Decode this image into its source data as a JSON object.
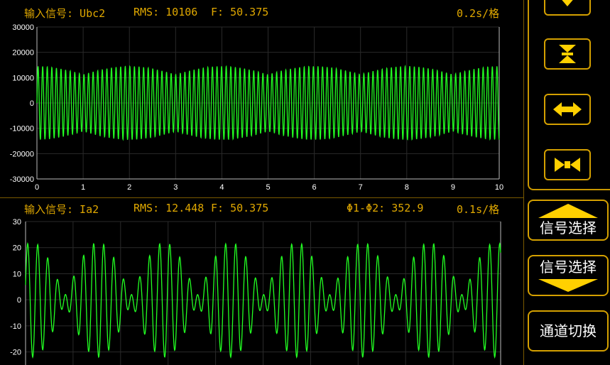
{
  "top_panel": {
    "signal_label": "输入信号: Ubc2",
    "rms": "RMS: 10106",
    "freq": "F: 50.375",
    "timebase": "0.2s/格",
    "y_ticks": [
      "30000",
      "20000",
      "10000",
      "0",
      "-10000",
      "-20000",
      "-30000"
    ],
    "x_ticks": [
      "0",
      "1",
      "2",
      "3",
      "4",
      "5",
      "6",
      "7",
      "8",
      "9",
      "10"
    ]
  },
  "bottom_panel": {
    "signal_label": "输入信号: Ia2",
    "rms": "RMS: 12.448",
    "freq": "F: 50.375",
    "phase": "Φ1-Φ2: 352.9",
    "timebase": "0.1s/格",
    "y_ticks": [
      "30",
      "20",
      "10",
      "0",
      "-10",
      "-20"
    ]
  },
  "buttons": {
    "signal_select_up": "信号选择",
    "signal_select_down": "信号选择",
    "channel_switch": "通道切换"
  },
  "colors": {
    "accent": "#ffc000",
    "trace": "#22ff22",
    "grid": "#2a2a2a",
    "background": "#000000"
  },
  "chart_data": [
    {
      "type": "line",
      "series": [
        {
          "amplitude_peak": 14500,
          "envelope_min": 8000
        }
      ],
      "ylim": [
        -30000,
        30000
      ],
      "xlim": [
        0,
        10
      ],
      "grid": true
    },
    {
      "type": "line",
      "series": [
        {
          "amplitude_peak": 22,
          "envelope_min": 6
        }
      ],
      "ylim": [
        -25,
        30
      ],
      "grid": true
    }
  ]
}
